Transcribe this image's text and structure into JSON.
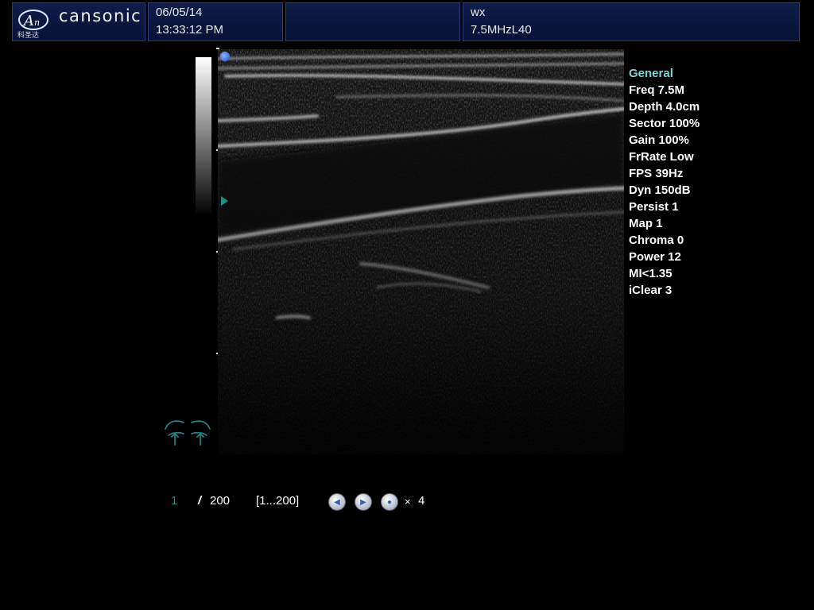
{
  "header": {
    "brand": "cansonic",
    "logo_text": "科圣达",
    "date": "06/05/14",
    "time": "13:33:12 PM",
    "patient": "wx",
    "probe": "7.5MHzL40"
  },
  "params": {
    "title": "General",
    "items": [
      "Freq 7.5M",
      "Depth 4.0cm",
      "Sector 100%",
      "Gain 100%",
      "FrRate Low",
      "FPS 39Hz",
      "Dyn 150dB",
      "Persist 1",
      "Map 1",
      "Chroma 0",
      "Power 12",
      "MI<1.35",
      "iClear 3"
    ]
  },
  "cine": {
    "current_frame": "1",
    "separator": "/",
    "total_frames": "200",
    "range": "[1...200]",
    "speed_prefix": "×",
    "speed_value": "4"
  },
  "icons": {
    "orientation": "orientation-dot-icon",
    "focus": "focus-marker-icon",
    "body_mark": "breast-body-mark-icon",
    "prev": "previous-frame-icon",
    "play": "play-icon",
    "speed": "speed-icon"
  },
  "colors": {
    "header_bg": "#0b1a45",
    "accent_teal": "#1f8c8c",
    "param_title": "#7fd3d3",
    "orientation_blue": "#1c4bd6"
  }
}
